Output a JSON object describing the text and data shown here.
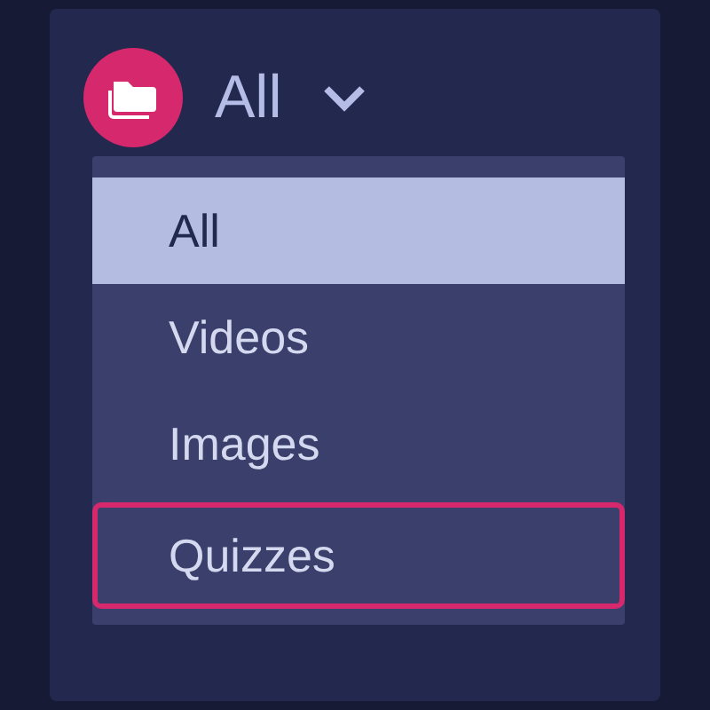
{
  "filter": {
    "label": "All",
    "expanded": true
  },
  "options": [
    {
      "label": "All",
      "selected": true,
      "focused": false
    },
    {
      "label": "Videos",
      "selected": false,
      "focused": false
    },
    {
      "label": "Images",
      "selected": false,
      "focused": false
    },
    {
      "label": "Quizzes",
      "selected": false,
      "focused": true
    }
  ]
}
